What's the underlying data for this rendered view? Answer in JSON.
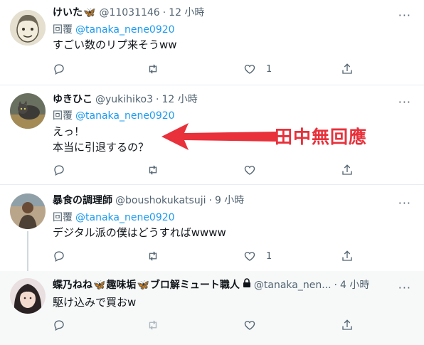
{
  "annotation": {
    "text": "田中無回應",
    "color": "#e8313b"
  },
  "tweets": [
    {
      "name": "けいた",
      "name_emoji": "🦋",
      "handle": "@11031146",
      "time": "12 小時",
      "reply_label": "回覆",
      "reply_to": "@tanaka_nene0920",
      "text": "すごい数のリプ来そうww",
      "likes": "1",
      "avatar": "sketch-portrait"
    },
    {
      "name": "ゆきひこ",
      "handle": "@yukihiko3",
      "time": "12 小時",
      "reply_label": "回覆",
      "reply_to": "@tanaka_nene0920",
      "text": "えっ！\n本当に引退するの？",
      "likes": "",
      "avatar": "cat-photo"
    },
    {
      "name": "暴食の調理師",
      "handle": "@boushokukatsuji",
      "time": "9 小時",
      "reply_label": "回覆",
      "reply_to": "@tanaka_nene0920",
      "text": "デジタル派の僕はどうすればwwww",
      "likes": "1",
      "avatar": "person-photo"
    },
    {
      "name_parts": [
        "蝶乃ねね",
        "🦋",
        "趣味垢",
        "🦋",
        "ブロ解ミュート職人"
      ],
      "handle": "@tanaka_nen...",
      "time": "4 小時",
      "text": "駆け込みで買おw",
      "likes": "",
      "avatar": "girl-photo"
    }
  ],
  "colors": {
    "link": "#1d9bf0",
    "secondary": "#536471",
    "divider": "#e6ecf0"
  }
}
